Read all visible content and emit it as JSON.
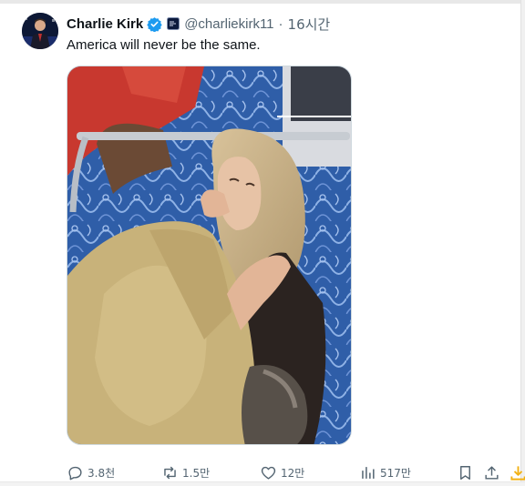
{
  "colors": {
    "accent": "#1d9bf0",
    "text": "#0f1419",
    "muted": "#536471",
    "download": "#f2b114"
  },
  "post": {
    "author_name": "Charlie Kirk",
    "handle": "@charliekirk11",
    "separator": "·",
    "time": "16시간",
    "text": "America will never be the same."
  },
  "actions": {
    "replies": "3.8천",
    "reposts": "1.5만",
    "likes": "12만",
    "views": "517만"
  },
  "icons": [
    "verified-badge-icon",
    "affiliate-badge-icon",
    "reply-icon",
    "repost-icon",
    "like-icon",
    "views-icon",
    "bookmark-icon",
    "share-icon",
    "download-icon"
  ]
}
